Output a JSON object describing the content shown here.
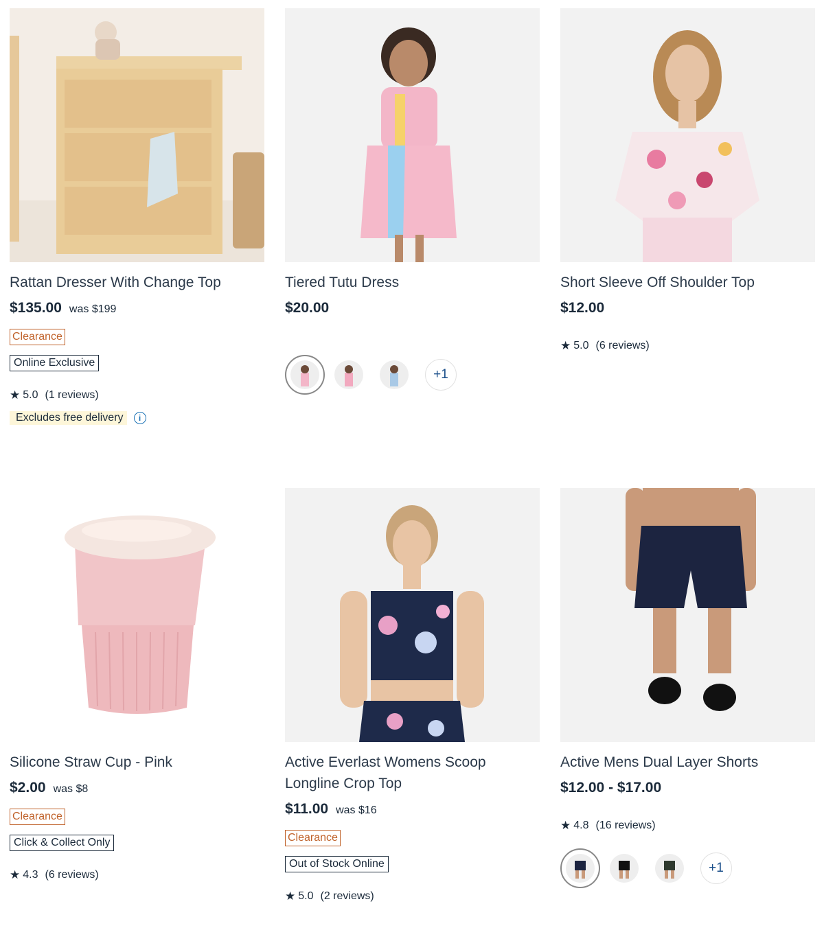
{
  "products": [
    {
      "title": "Rattan Dresser With Change Top",
      "price": "$135.00",
      "was": "was $199",
      "badges": [
        "Clearance",
        "Online Exclusive"
      ],
      "rating": "5.0",
      "reviews": "(1 reviews)",
      "delivery_note": "Excludes free delivery",
      "info_icon": "i"
    },
    {
      "title": "Tiered Tutu Dress",
      "price": "$20.00",
      "swatch_more": "+1"
    },
    {
      "title": "Short Sleeve Off Shoulder Top",
      "price": "$12.00",
      "rating": "5.0",
      "reviews": "(6 reviews)"
    },
    {
      "title": "Silicone Straw Cup - Pink",
      "price": "$2.00",
      "was": "was $8",
      "badges": [
        "Clearance",
        "Click & Collect Only"
      ],
      "rating": "4.3",
      "reviews": "(6 reviews)"
    },
    {
      "title": "Active Everlast Womens Scoop Longline Crop Top",
      "price": "$11.00",
      "was": "was $16",
      "badges": [
        "Clearance",
        "Out of Stock Online"
      ],
      "rating": "5.0",
      "reviews": "(2 reviews)"
    },
    {
      "title": "Active Mens Dual Layer Shorts",
      "price": "$12.00 - $17.00",
      "rating": "4.8",
      "reviews": "(16 reviews)",
      "swatch_more": "+1"
    }
  ],
  "star_glyph": "★",
  "colors": {
    "clearance": "#c0622a",
    "text": "#1b2a3a",
    "link_blue": "#1a72b5",
    "delivery_bg": "#fdf6d9"
  }
}
